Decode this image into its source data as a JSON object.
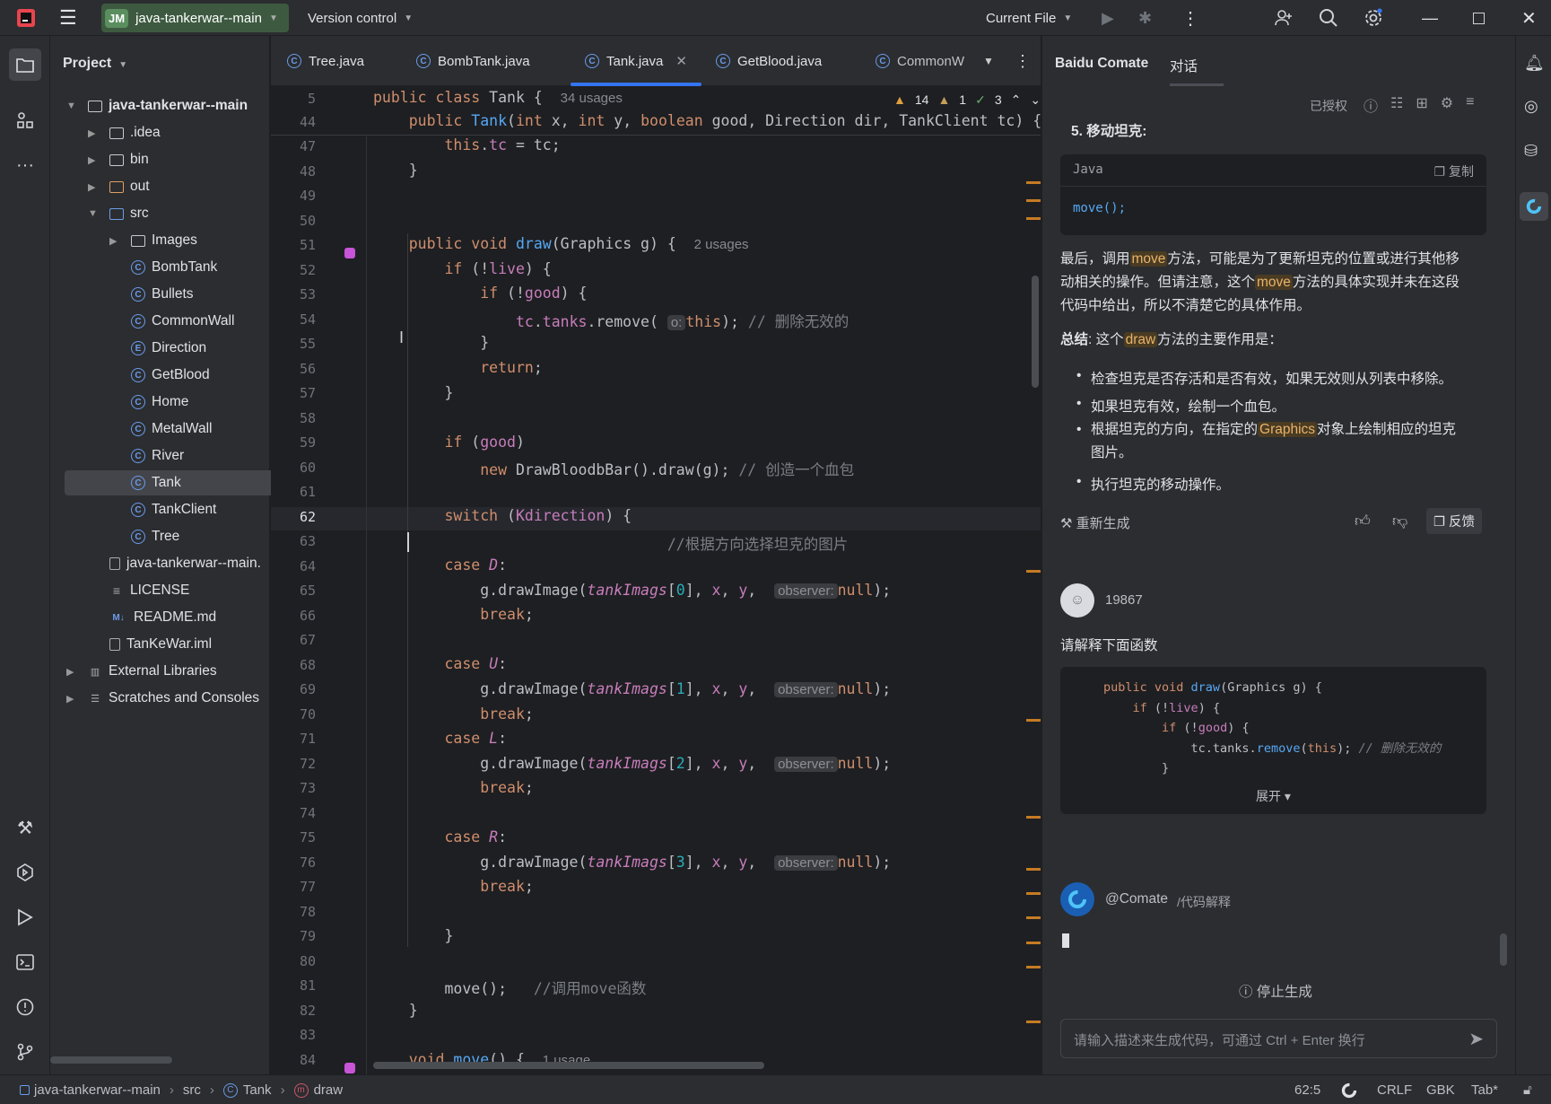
{
  "titlebar": {
    "project_initials": "JM",
    "project_name": "java-tankerwar--main",
    "vcs": "Version control",
    "run_config": "Current File"
  },
  "project_panel": {
    "title": "Project",
    "root": "java-tankerwar--main",
    "items": {
      "idea": ".idea",
      "bin": "bin",
      "out": "out",
      "src": "src",
      "images": "Images",
      "bombtank": "BombTank",
      "bullets": "Bullets",
      "commonwall": "CommonWall",
      "direction": "Direction",
      "getblood": "GetBlood",
      "home": "Home",
      "metalwall": "MetalWall",
      "river": "River",
      "tank": "Tank",
      "tankclient": "TankClient",
      "tree": "Tree",
      "mainfile": "java-tankerwar--main.",
      "license": "LICENSE",
      "readme": "README.md",
      "iml": "TanKeWar.iml",
      "external": "External Libraries",
      "scratches": "Scratches and Consoles"
    }
  },
  "editor": {
    "tabs": [
      "Tree.java",
      "BombTank.java",
      "Tank.java",
      "GetBlood.java",
      "CommonW"
    ],
    "inspections": {
      "warnings": "14",
      "weak": "1",
      "ok": "3"
    },
    "sticky": {
      "line1_num": "5",
      "line1_code": "public class Tank {",
      "line1_hint": "34 usages",
      "line2_num": "44",
      "line2_code": "    public Tank(int x, int y, boolean good, Direction dir, TankClient tc) {"
    },
    "hints": {
      "draw_usages": "2 usages",
      "move_usages": "1 usage",
      "observer": "observer:",
      "o": "o:"
    },
    "comments": {
      "remove": "// 删除无效的",
      "blood": "// 创造一个血包",
      "dir": "//根据方向选择坦克的图片",
      "move": "//调用move函数"
    },
    "line_numbers": [
      "47",
      "48",
      "49",
      "50",
      "51",
      "52",
      "53",
      "54",
      "55",
      "56",
      "57",
      "58",
      "59",
      "60",
      "61",
      "62",
      "63",
      "64",
      "65",
      "66",
      "67",
      "68",
      "69",
      "70",
      "71",
      "72",
      "73",
      "74",
      "75",
      "76",
      "77",
      "78",
      "79",
      "80",
      "81",
      "82",
      "83",
      "84"
    ]
  },
  "comate": {
    "title": "Baidu Comate",
    "tab": "对话",
    "authorized": "已授权",
    "step_heading": "5. 移动坦克:",
    "code_lang": "Java",
    "copy": "复制",
    "code_snippet": "move();",
    "para1_a": "最后，调用",
    "para1_hl": "move",
    "para1_b": "方法，可能是为了更新坦克的位置或进行其他移",
    "para1_c": "动相关的操作。但请注意，这个",
    "para1_hl2": "move",
    "para1_d": "方法的具体实现并未在这段",
    "para1_e": "代码中给出，所以不清楚它的具体作用。",
    "summary_bold": "总结",
    "summary_a": ": 这个",
    "summary_hl": "draw",
    "summary_b": "方法的主要作用是：",
    "bullets": [
      "检查坦克是否存活和是否有效，如果无效则从列表中移除。",
      "如果坦克有效，绘制一个血包。",
      "执行坦克的移动操作。"
    ],
    "bullet3_a": "根据坦克的方向，在指定的",
    "bullet3_hl": "Graphics",
    "bullet3_b": "对象上绘制相应的坦克",
    "bullet3_c": "图片。",
    "regenerate": "重新生成",
    "feedback": "反馈",
    "user": "19867",
    "user_msg": "请解释下面函数",
    "expand": "展开",
    "bot_name": "@Comate",
    "bot_cmd": "/代码解释",
    "stop": "停止生成",
    "input_placeholder": "请输入描述来生成代码，可通过 Ctrl + Enter 换行"
  },
  "statusbar": {
    "crumb1": "java-tankerwar--main",
    "crumb2": "src",
    "crumb3": "Tank",
    "crumb4": "draw",
    "position": "62:5",
    "line_sep": "CRLF",
    "encoding": "GBK",
    "indent": "Tab*"
  }
}
